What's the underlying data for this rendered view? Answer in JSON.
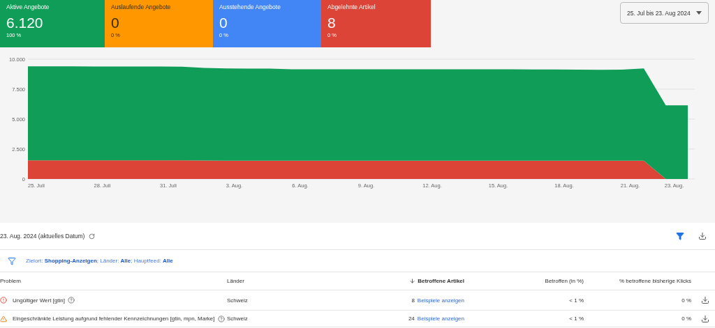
{
  "cards": [
    {
      "label": "Aktive Angebote",
      "value": "6.120",
      "share": "100 %",
      "color": "#0f9d58"
    },
    {
      "label": "Auslaufende Angebote",
      "value": "0",
      "share": "0 %",
      "color": "#ff9800"
    },
    {
      "label": "Ausstehende Angebote",
      "value": "0",
      "share": "0 %",
      "color": "#4285f4"
    },
    {
      "label": "Abgelehnte Artikel",
      "value": "8",
      "share": "0 %",
      "color": "#db4437"
    }
  ],
  "date_range": {
    "value": "25. Jul bis 23. Aug 2024"
  },
  "chart": {
    "chart_data": {
      "type": "area",
      "stacked": true,
      "grid": true,
      "categories": [
        "25. Juli",
        null,
        null,
        "28. Juli",
        null,
        null,
        "31. Juli",
        null,
        null,
        "3. Aug.",
        null,
        null,
        "6. Aug.",
        null,
        null,
        "9. Aug.",
        null,
        null,
        "12. Aug.",
        null,
        null,
        "15. Aug.",
        null,
        null,
        "18. Aug.",
        null,
        null,
        "21. Aug.",
        null,
        "23. Aug.",
        null
      ],
      "series": [
        {
          "color": "#db4437",
          "values": [
            1550,
            1550,
            1550,
            1550,
            1550,
            1550,
            1550,
            1550,
            1540,
            1530,
            1530,
            1530,
            1530,
            1530,
            1530,
            1530,
            1530,
            1530,
            1530,
            1530,
            1530,
            1530,
            1530,
            1530,
            1530,
            1530,
            1530,
            1530,
            1530,
            0,
            0
          ]
        },
        {
          "color": "#0f9d58",
          "values": [
            7850,
            7850,
            7850,
            7840,
            7840,
            7840,
            7840,
            7830,
            7740,
            7700,
            7690,
            7680,
            7620,
            7630,
            7630,
            7630,
            7630,
            7630,
            7630,
            7630,
            7630,
            7630,
            7620,
            7610,
            7610,
            7600,
            7580,
            7600,
            7700,
            6150,
            6150
          ]
        }
      ],
      "ylim": [
        0,
        10000
      ],
      "yticks": [
        {
          "value": 0,
          "label": "0"
        },
        {
          "value": 2500,
          "label": "2.500"
        },
        {
          "value": 5000,
          "label": "5.000"
        },
        {
          "value": 7500,
          "label": "7.500"
        },
        {
          "value": 10000,
          "label": "10.000"
        }
      ]
    }
  },
  "summary": {
    "date": "23. Aug. 2024 (aktuelles Datum)"
  },
  "filter": {
    "text": "Zielort: **Shopping-Anzeigen**; Länder: **Alle**; Hauptfeed: **Alle**"
  },
  "table": {
    "columns": [
      "Problem",
      "Länder",
      "Betroffene Artikel",
      "Betroffen (in %)",
      "% betroffene bisherige Klicks"
    ],
    "rows": [
      {
        "kind": "error",
        "problem": "Ungültiger Wert [gtin]",
        "country": "Schweiz",
        "count": "8",
        "link": "Beispiele anzeigen",
        "share": "< 1 %",
        "clicks": "0 %"
      },
      {
        "kind": "warning",
        "problem": "Eingeschränkte Leistung aufgrund fehlender Kennzeichnungen [gtin, mpn, Marke]",
        "country": "Schweiz",
        "count": "24",
        "link": "Beispiele anzeigen",
        "share": "< 1 %",
        "clicks": "0 %"
      }
    ]
  }
}
